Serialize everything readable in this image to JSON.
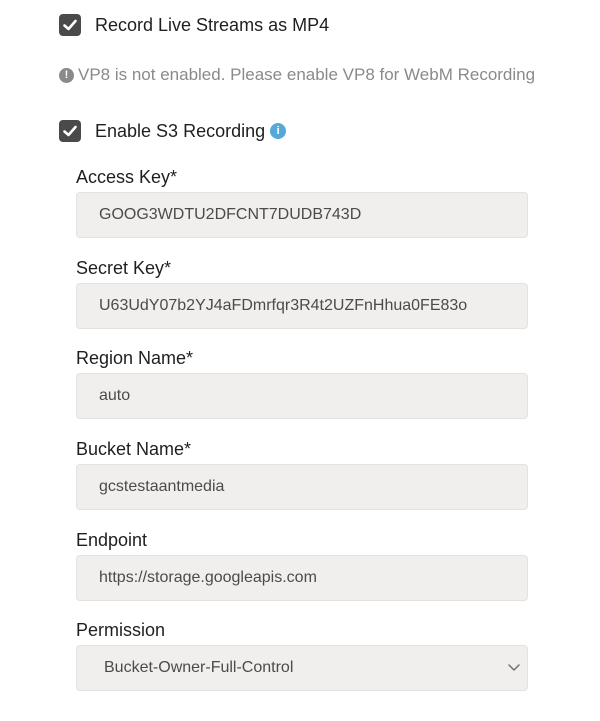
{
  "record_mp4": {
    "label": "Record Live Streams as MP4",
    "checked": true
  },
  "vp8_warning": {
    "icon": "exclamation-circle-icon",
    "text": "VP8 is not enabled. Please enable VP8 for WebM Recording"
  },
  "s3_recording": {
    "label": "Enable S3 Recording",
    "checked": true,
    "info_icon": "info-icon"
  },
  "fields": {
    "access_key": {
      "label": "Access Key*",
      "value": "GOOG3WDTU2DFCNT7DUDB743D"
    },
    "secret_key": {
      "label": "Secret Key*",
      "value": "U63UdY07b2YJ4aFDmrfqr3R4t2UZFnHhua0FE83o"
    },
    "region_name": {
      "label": "Region Name*",
      "value": "auto"
    },
    "bucket_name": {
      "label": "Bucket Name*",
      "value": "gcstestaantmedia"
    },
    "endpoint": {
      "label": "Endpoint",
      "value": "https://storage.googleapis.com"
    },
    "permission": {
      "label": "Permission",
      "selected": "Bucket-Owner-Full-Control"
    }
  },
  "colors": {
    "checkbox": "#4a4a4a",
    "info": "#55a9d9",
    "warning": "#8a8a8a",
    "field_bg": "#f0efed"
  }
}
